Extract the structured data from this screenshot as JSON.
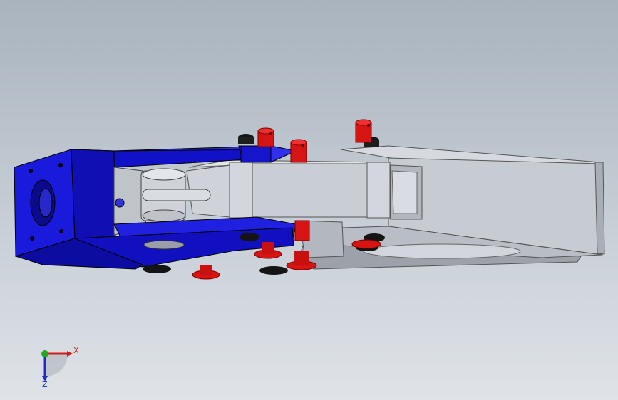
{
  "viewport": {
    "background_top": "#a9b3be",
    "background_bottom": "#dfe3e8"
  },
  "colors": {
    "blue_part": "#1414d6",
    "blue_dark": "#0a0a9a",
    "blue_light": "#3a3af0",
    "gray_part": "#c3c7cf",
    "gray_dark": "#8e939c",
    "gray_light": "#dde0e6",
    "red_pin": "#d71414",
    "black_part": "#141414"
  },
  "triad": {
    "x_label": "X",
    "z_label": "Z",
    "x_color": "#d21a1a",
    "y_color": "#1ea91e",
    "z_color": "#1c2ccc"
  }
}
